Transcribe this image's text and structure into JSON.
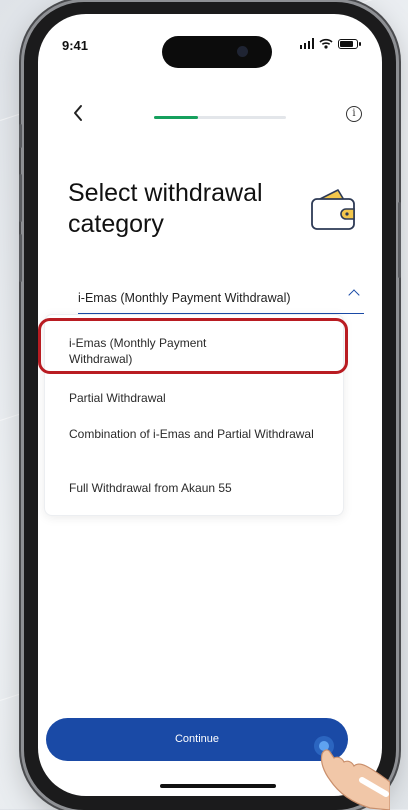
{
  "status_bar": {
    "time": "9:41"
  },
  "header": {
    "back_icon": "chevron-left-icon",
    "info_icon": "info-icon",
    "info_glyph": "i",
    "progress_fraction": 0.33
  },
  "page": {
    "title": "Select withdrawal category",
    "illustration": "wallet-icon"
  },
  "dropdown": {
    "selected_value": "i-Emas (Monthly Payment Withdrawal)",
    "expanded": true,
    "options": [
      "i-Emas (Monthly Payment Withdrawal)",
      "Partial Withdrawal",
      "Combination of i-Emas and Partial Withdrawal",
      "Full Withdrawal from Akaun 55"
    ]
  },
  "footer": {
    "continue_label": "Continue"
  },
  "colors": {
    "primary": "#1a4aa6",
    "progress": "#16a05d",
    "highlight": "#b91c22"
  }
}
